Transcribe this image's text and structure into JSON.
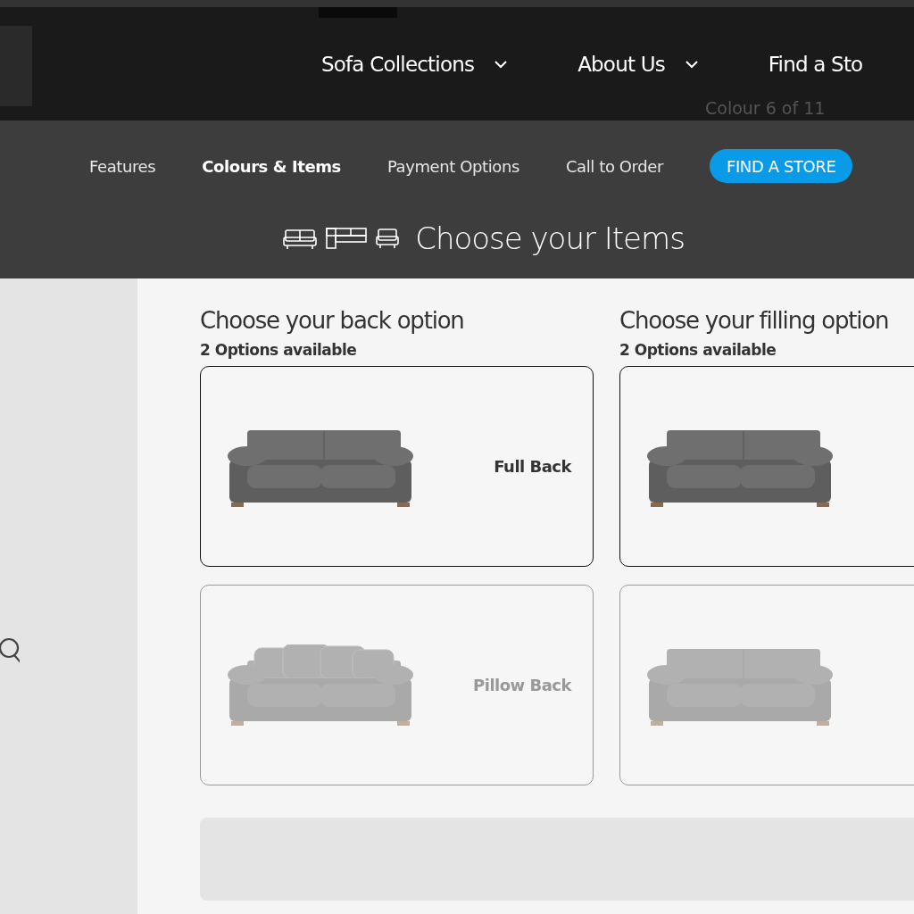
{
  "header": {
    "nav": [
      {
        "label": "Sofa Collections",
        "dropdown": true
      },
      {
        "label": "About Us",
        "dropdown": true
      },
      {
        "label": "Find a Sto",
        "dropdown": false
      }
    ],
    "behind_text": "Colour 6 of 11"
  },
  "subnav": {
    "links": [
      {
        "label": "Features",
        "selected": false
      },
      {
        "label": "Colours & Items",
        "selected": true
      },
      {
        "label": "Payment Options",
        "selected": false
      },
      {
        "label": "Call to Order",
        "selected": false
      }
    ],
    "button": "FIND A STORE"
  },
  "section_title": "Choose your Items",
  "groups": [
    {
      "title": "Choose your back option",
      "subtitle": "2 Options available",
      "options": [
        {
          "label": "Full Back",
          "kind": "full",
          "selected": true
        },
        {
          "label": "Pillow Back",
          "kind": "pillow",
          "selected": false
        }
      ]
    },
    {
      "title": "Choose your filling option",
      "subtitle": "2 Options available",
      "options": [
        {
          "kind": "full",
          "selected": true
        },
        {
          "kind": "full",
          "selected": false
        }
      ]
    }
  ]
}
